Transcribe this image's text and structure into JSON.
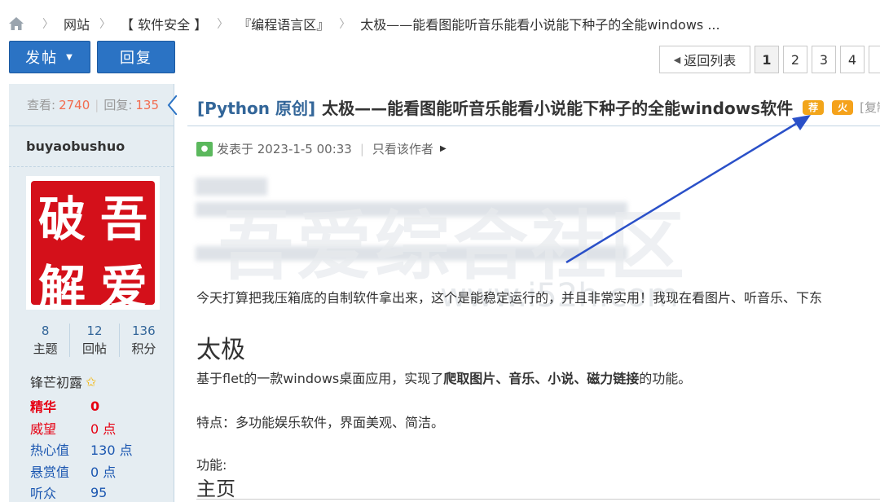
{
  "breadcrumb": {
    "items": [
      "网站",
      "【 软件安全 】",
      "『编程语言区』",
      "太极——能看图能听音乐能看小说能下种子的全能windows ..."
    ]
  },
  "actions": {
    "post": "发帖",
    "reply": "回复"
  },
  "pager": {
    "back": "返回列表",
    "pages": [
      "1",
      "2",
      "3",
      "4"
    ],
    "current": "1"
  },
  "thread_stats": {
    "views_label": "查看:",
    "views": "2740",
    "replies_label": "回复:",
    "replies": "135"
  },
  "author": {
    "name": "buyaobushuo",
    "avatar_text": [
      "吾",
      "破",
      "爱",
      "解"
    ],
    "counts": [
      {
        "value": "8",
        "label": "主题"
      },
      {
        "value": "12",
        "label": "回帖"
      },
      {
        "value": "136",
        "label": "积分"
      }
    ],
    "rank": "锋芒初露",
    "props": [
      {
        "key": "精华",
        "value": "0",
        "color": "#e60012",
        "bold": true
      },
      {
        "key": "威望",
        "value": "0 点",
        "color": "#e60012",
        "bold": false
      },
      {
        "key": "热心值",
        "value": "130 点",
        "color": "#1a56b0",
        "bold": false
      },
      {
        "key": "悬赏值",
        "value": "0 点",
        "color": "#1a56b0",
        "bold": false
      },
      {
        "key": "听众",
        "value": "95",
        "color": "#1a56b0",
        "bold": false
      }
    ]
  },
  "post": {
    "tag": "[Python 原创]",
    "title": "太极——能看图能听音乐能看小说能下种子的全能windows软件",
    "badge1": "荐",
    "badge2": "火",
    "copy_label": "[复制",
    "meta_posted": "发表于 2023-1-5 00:33",
    "meta_author_only": "只看该作者",
    "intro": "今天打算把我压箱底的自制软件拿出来，这个是能稳定运行的，并且非常实用！我现在看图片、听音乐、下东",
    "heading": "太极",
    "desc_prefix": "基于flet的一款windows桌面应用，实现了",
    "desc_bold": "爬取图片、音乐、小说、磁力链接",
    "desc_suffix": "的功能。",
    "features": "特点：多功能娱乐软件，界面美观、简洁。",
    "functions_label": "功能:",
    "subheading": "主页"
  },
  "watermark": {
    "main": "吾爱综合社区",
    "sub": "www.i52h.com"
  }
}
